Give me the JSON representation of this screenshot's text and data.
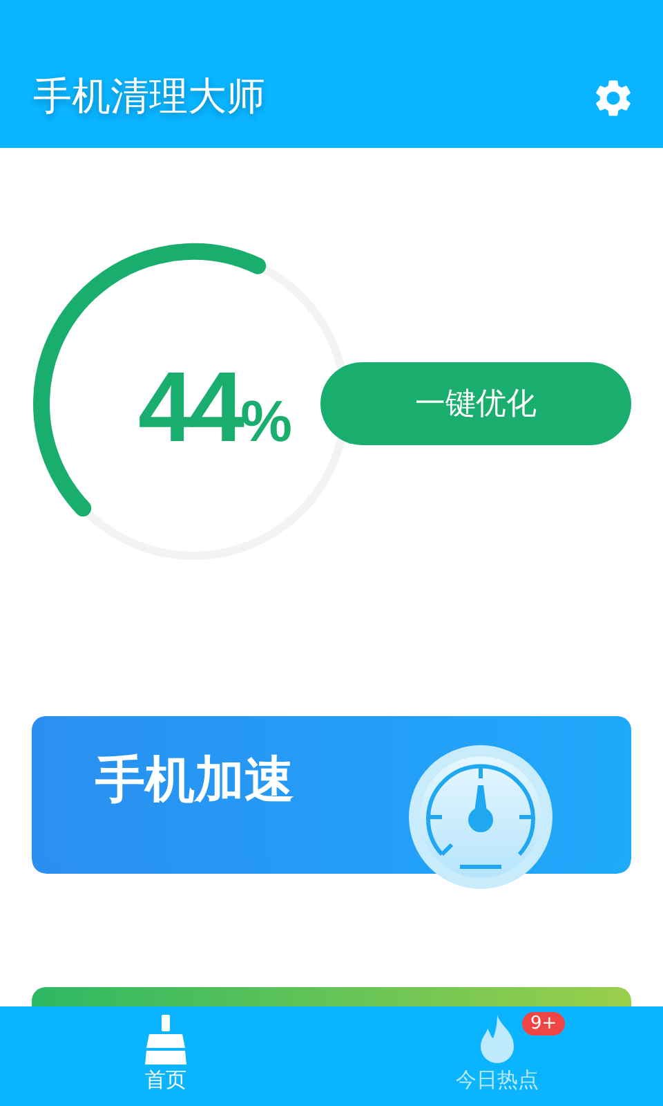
{
  "app_bar": {
    "title": "手机清理大师"
  },
  "memory": {
    "level": 0.44,
    "value": "44",
    "unit": "%",
    "button": "一键优化"
  },
  "cards": [
    {
      "kind": "speed",
      "title": "手机加速"
    },
    {
      "kind": "plain"
    }
  ],
  "bottom_nav": [
    {
      "label": "首页",
      "kind": "home",
      "selected": true
    },
    {
      "label": "今日热点",
      "kind": "hot",
      "selected": false,
      "badge": "9+"
    }
  ]
}
